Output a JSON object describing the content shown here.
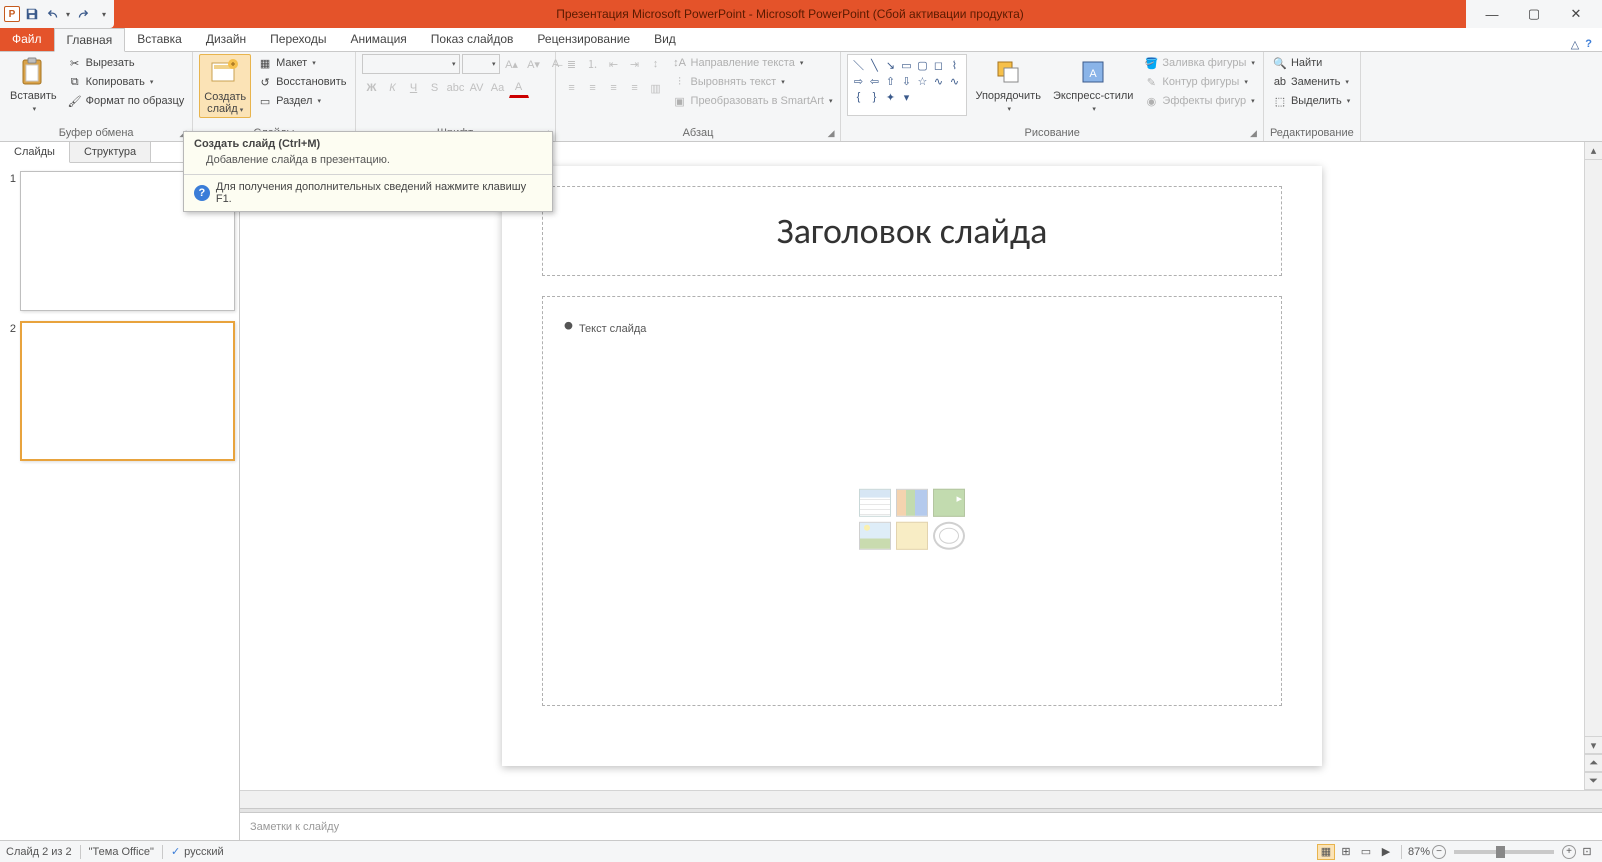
{
  "titlebar": {
    "title": "Презентация Microsoft PowerPoint  -  Microsoft PowerPoint (Сбой активации продукта)"
  },
  "tabs": {
    "file": "Файл",
    "home": "Главная",
    "insert": "Вставка",
    "design": "Дизайн",
    "transitions": "Переходы",
    "animations": "Анимация",
    "slideshow": "Показ слайдов",
    "review": "Рецензирование",
    "view": "Вид"
  },
  "ribbon": {
    "clipboard": {
      "label": "Буфер обмена",
      "paste": "Вставить",
      "cut": "Вырезать",
      "copy": "Копировать",
      "formatPainter": "Формат по образцу"
    },
    "slides": {
      "label": "Слайды",
      "newSlide": "Создать\nслайд",
      "layout": "Макет",
      "reset": "Восстановить",
      "section": "Раздел"
    },
    "font": {
      "label": "Шрифт"
    },
    "paragraph": {
      "label": "Абзац",
      "textDirection": "Направление текста",
      "alignText": "Выровнять текст",
      "convertSmart": "Преобразовать в SmartArt"
    },
    "drawing": {
      "label": "Рисование",
      "arrange": "Упорядочить",
      "quickStyles": "Экспресс-стили",
      "shapeFill": "Заливка фигуры",
      "shapeOutline": "Контур фигуры",
      "shapeEffects": "Эффекты фигур"
    },
    "editing": {
      "label": "Редактирование",
      "find": "Найти",
      "replace": "Заменить",
      "select": "Выделить"
    }
  },
  "panel": {
    "slidesTab": "Слайды",
    "outlineTab": "Структура",
    "slide1": "1",
    "slide2": "2"
  },
  "slide": {
    "title": "Заголовок слайда",
    "body": "Текст слайда"
  },
  "notes": {
    "placeholder": "Заметки к слайду"
  },
  "tooltip": {
    "title": "Создать слайд (Ctrl+M)",
    "body": "Добавление слайда в презентацию.",
    "help": "Для получения дополнительных сведений нажмите клавишу F1."
  },
  "status": {
    "slideInfo": "Слайд 2 из 2",
    "theme": "\"Тема Office\"",
    "language": "русский",
    "zoom": "87%"
  }
}
